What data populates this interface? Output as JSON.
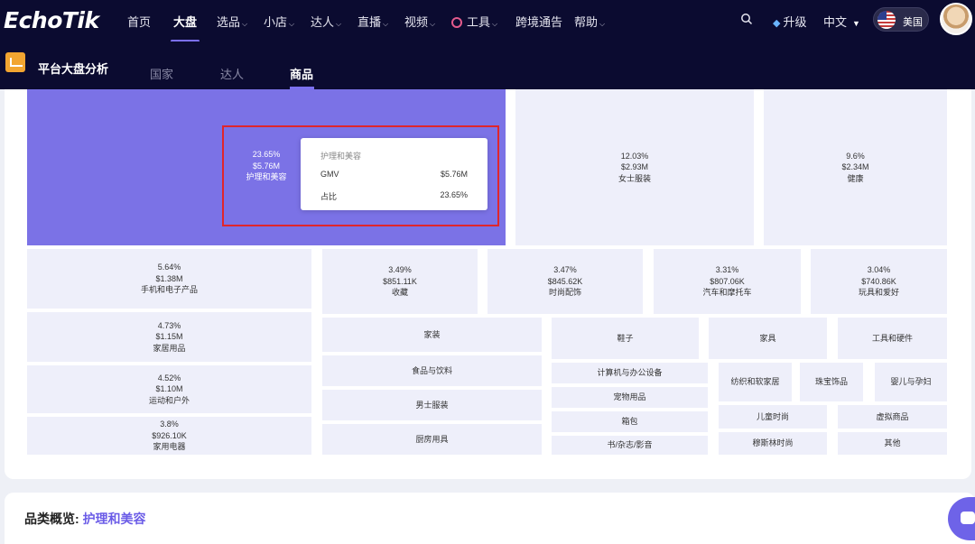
{
  "brand": {
    "logo": "EchoTik"
  },
  "nav": {
    "items": [
      {
        "label": "首页",
        "caret": false
      },
      {
        "label": "大盘",
        "caret": false,
        "active": true
      },
      {
        "label": "选品",
        "caret": true
      },
      {
        "label": "小店",
        "caret": true
      },
      {
        "label": "达人",
        "caret": true
      },
      {
        "label": "直播",
        "caret": true
      },
      {
        "label": "视频",
        "caret": true
      },
      {
        "label": "工具",
        "caret": true
      },
      {
        "label": "跨境通告",
        "caret": false
      },
      {
        "label": "帮助",
        "caret": true
      }
    ],
    "upgrade": "升级",
    "language": "中文",
    "region": "美国"
  },
  "subnav": {
    "title": "平台大盘分析",
    "tabs": [
      "国家",
      "达人",
      "商品"
    ],
    "active_tab": 2
  },
  "treemap": {
    "cells": [
      {
        "pct": "23.65%",
        "gmv": "$5.76M",
        "name": "护理和美容"
      },
      {
        "pct": "12.03%",
        "gmv": "$2.93M",
        "name": "女士服装"
      },
      {
        "pct": "9.6%",
        "gmv": "$2.34M",
        "name": "健康"
      },
      {
        "pct": "5.64%",
        "gmv": "$1.38M",
        "name": "手机和电子产品"
      },
      {
        "pct": "3.49%",
        "gmv": "$851.11K",
        "name": "收藏"
      },
      {
        "pct": "3.47%",
        "gmv": "$845.62K",
        "name": "时尚配饰"
      },
      {
        "pct": "3.31%",
        "gmv": "$807.06K",
        "name": "汽车和摩托车"
      },
      {
        "pct": "3.04%",
        "gmv": "$740.86K",
        "name": "玩具和爱好"
      },
      {
        "pct": "4.73%",
        "gmv": "$1.15M",
        "name": "家居用品"
      },
      {
        "pct": "4.52%",
        "gmv": "$1.10M",
        "name": "运动和户外"
      },
      {
        "pct": "3.8%",
        "gmv": "$926.10K",
        "name": "家用电器"
      },
      {
        "name": "家装"
      },
      {
        "name": "食品与饮料"
      },
      {
        "name": "男士服装"
      },
      {
        "name": "厨房用具"
      },
      {
        "name": "鞋子"
      },
      {
        "name": "家具"
      },
      {
        "name": "工具和硬件"
      },
      {
        "name": "计算机与办公设备"
      },
      {
        "name": "宠物用品"
      },
      {
        "name": "箱包"
      },
      {
        "name": "书/杂志/影音"
      },
      {
        "name": "纺织和软家居"
      },
      {
        "name": "珠宝饰品"
      },
      {
        "name": "婴儿与孕妇"
      },
      {
        "name": "儿童时尚"
      },
      {
        "name": "虚拟商品"
      },
      {
        "name": "穆斯林时尚"
      },
      {
        "name": "其他"
      }
    ]
  },
  "tooltip": {
    "title": "护理和美容",
    "rows": [
      {
        "key": "GMV",
        "value": "$5.76M"
      },
      {
        "key": "占比",
        "value": "23.65%"
      }
    ]
  },
  "overview": {
    "label": "品类概览:",
    "value": "护理和美容"
  },
  "colors": {
    "nav_bg": "#0b0b30",
    "accent": "#7b6ff0",
    "treemap_primary": "#7b72e6",
    "treemap_cell": "#eeeffa",
    "highlight_border": "#e0262c"
  }
}
